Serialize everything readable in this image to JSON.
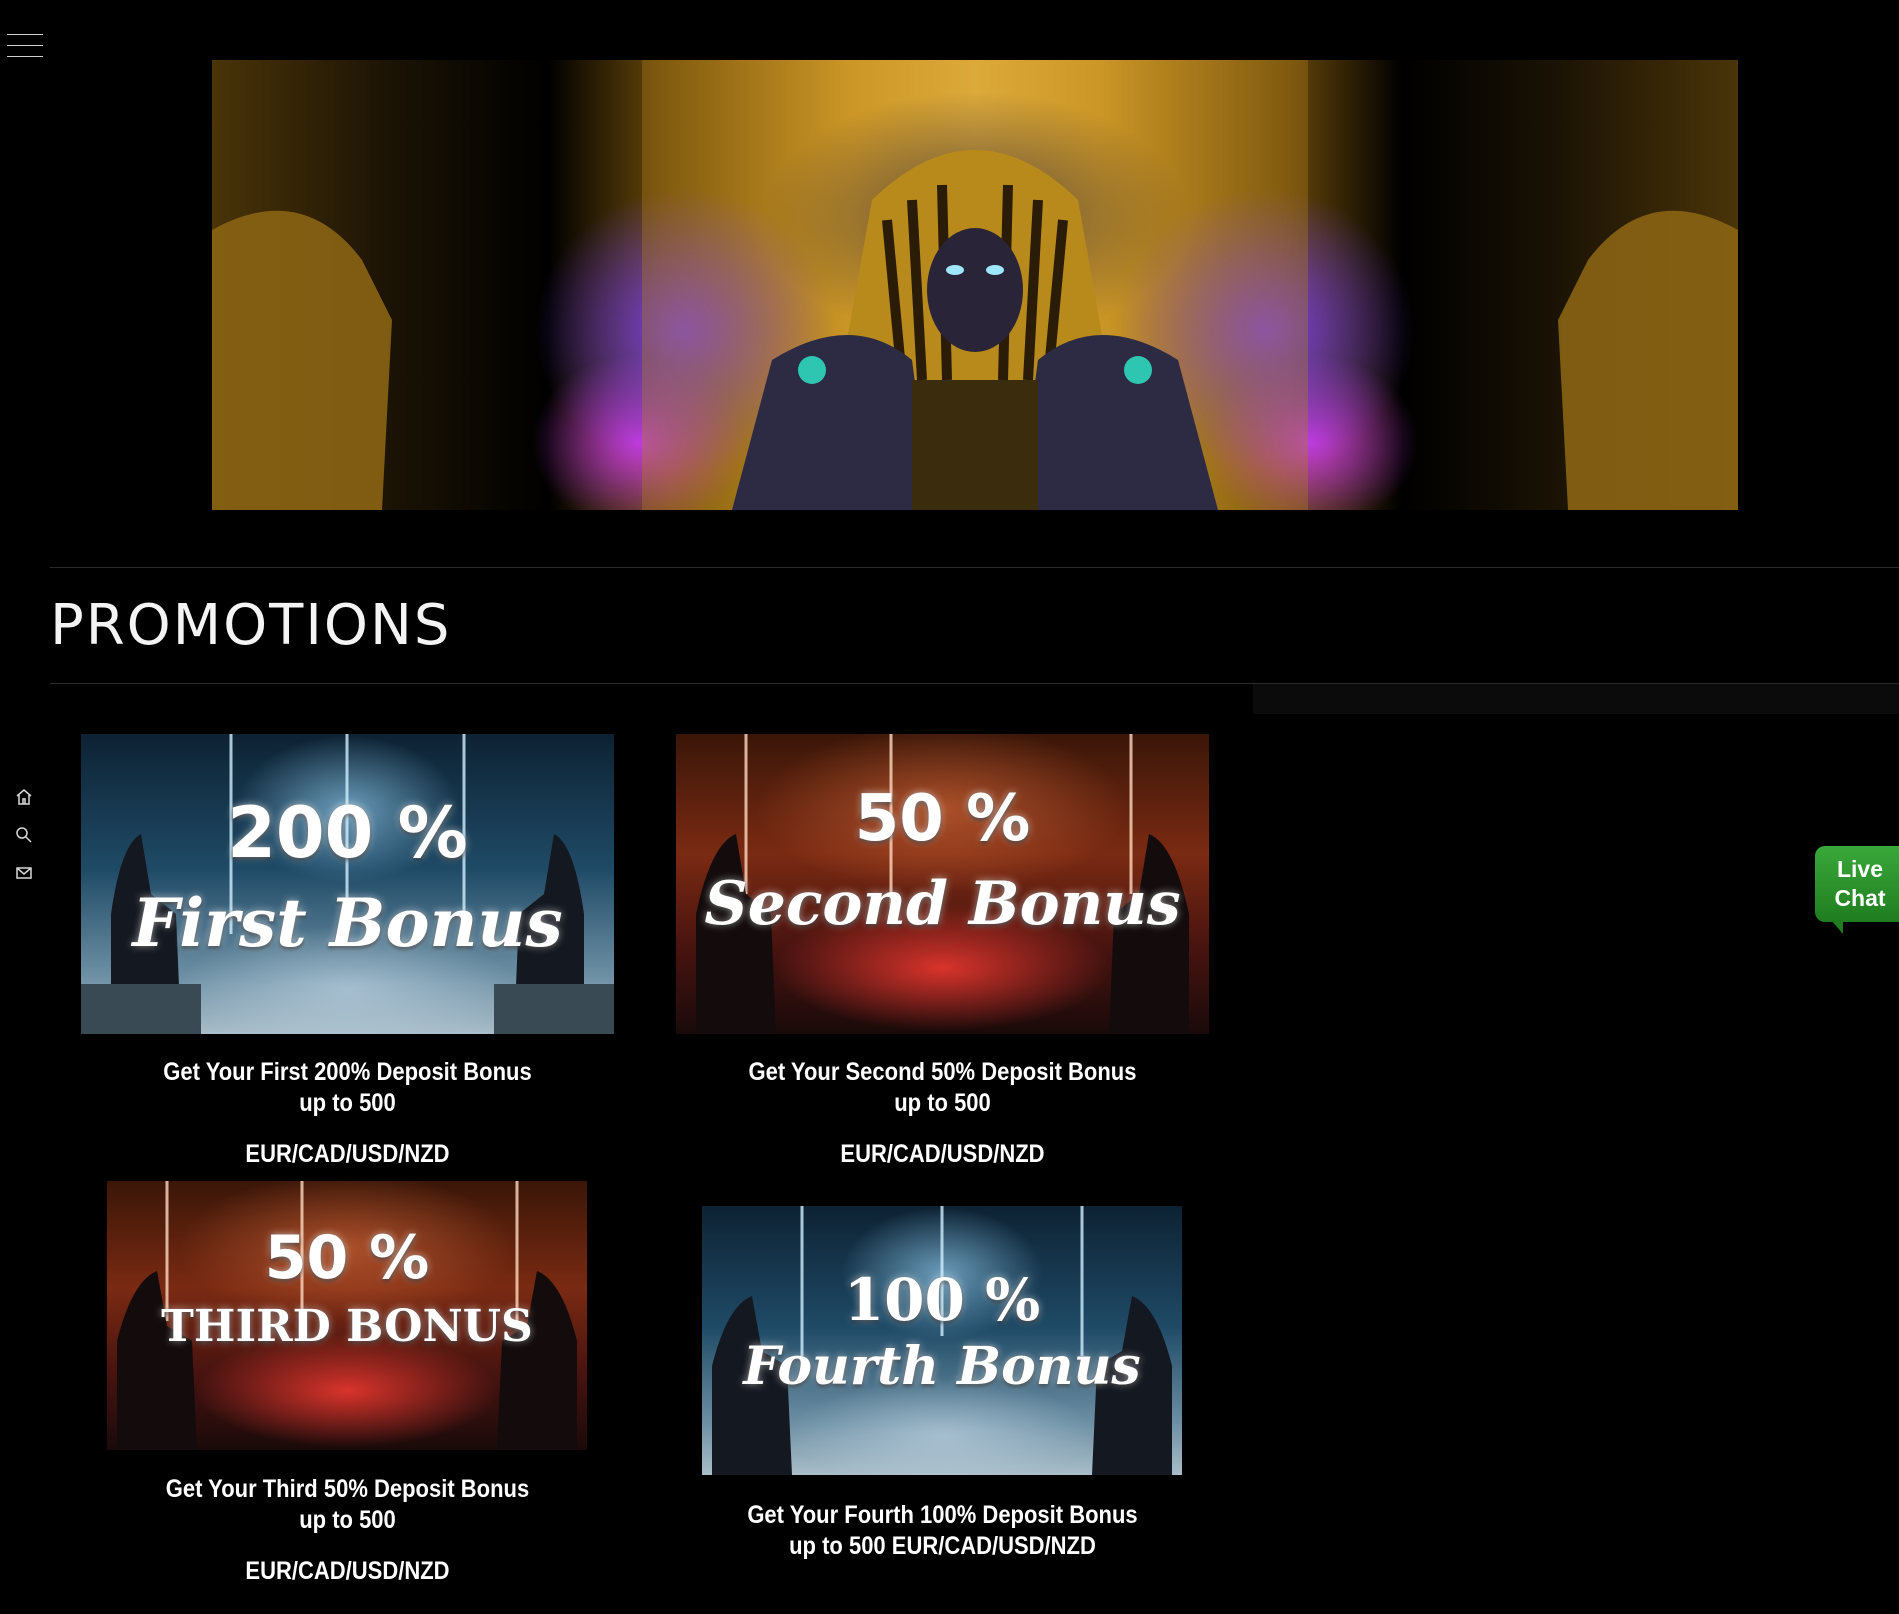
{
  "header": {
    "menu_icon": "hamburger-menu-icon"
  },
  "sidebar": {
    "icons": [
      "home-icon",
      "search-icon",
      "mail-icon"
    ]
  },
  "page": {
    "title": "PROMOTIONS"
  },
  "promos": [
    {
      "percent": "200 %",
      "name": "First Bonus",
      "line1": "Get Your First 200% Deposit Bonus",
      "line2": "up to 500",
      "currencies": "EUR/CAD/USD/NZD"
    },
    {
      "percent": "50 %",
      "name": "Second Bonus",
      "line1": "Get Your Second 50% Deposit Bonus",
      "line2": "up to 500",
      "currencies": "EUR/CAD/USD/NZD"
    },
    {
      "percent": "50 %",
      "name": "THIRD BONUS",
      "line1": "Get Your Third 50% Deposit Bonus",
      "line2": "up to 500",
      "currencies": "EUR/CAD/USD/NZD"
    },
    {
      "percent": "100 %",
      "name": "Fourth Bonus",
      "line1": "Get Your Fourth 100% Deposit Bonus",
      "line2": "up to 500 EUR/CAD/USD/NZD"
    }
  ],
  "live_chat": {
    "line1": "Live",
    "line2": "Chat"
  },
  "colors": {
    "background": "#000000",
    "live_chat_green": "#2e9a2e",
    "text": "#ffffff"
  }
}
